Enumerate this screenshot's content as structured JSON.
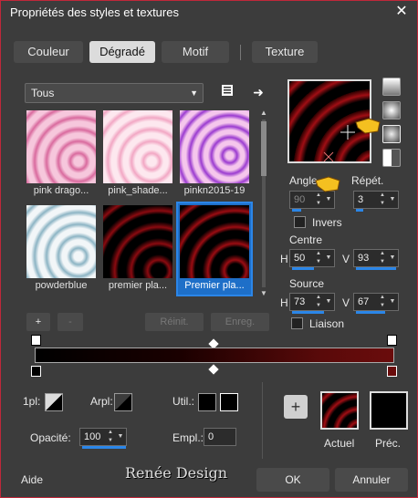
{
  "window": {
    "title": "Propriétés des styles et textures",
    "close_glyph": "✕"
  },
  "tabs": [
    {
      "label": "Couleur"
    },
    {
      "label": "Dégradé",
      "active": true
    },
    {
      "label": "Motif"
    },
    {
      "label": "Texture"
    }
  ],
  "category": {
    "selected": "Tous"
  },
  "gallery": {
    "items": [
      {
        "caption": "pink drago..."
      },
      {
        "caption": "pink_shade..."
      },
      {
        "caption": "pinkn2015-19"
      },
      {
        "caption": "powderblue"
      },
      {
        "caption": "premier pla..."
      },
      {
        "caption": "Premier pla...",
        "selected": true
      }
    ]
  },
  "gallery_buttons": {
    "add": "+",
    "remove": "-",
    "reset": "Réinit.",
    "save": "Enreg."
  },
  "params": {
    "angle_label": "Angle",
    "angle_value": "90",
    "repeat_label": "Répét.",
    "repeat_value": "3",
    "invert_label": "Invers",
    "center_label": "Centre",
    "center_h": "50",
    "center_v": "93",
    "source_label": "Source",
    "source_h": "73",
    "source_v": "67",
    "link_label": "Liaison",
    "h_label": "H",
    "v_label": "V"
  },
  "bottom": {
    "p1_label": "1pl:",
    "arpl_label": "Arpl:",
    "util_label": "Util.:",
    "opacity_label": "Opacité:",
    "opacity_value": "100",
    "empl_label": "Empl.:",
    "empl_value": "0",
    "add_glyph": "+",
    "current_label": "Actuel",
    "previous_label": "Préc."
  },
  "footer": {
    "help": "Aide",
    "logo": "Renée Design",
    "ok": "OK",
    "cancel": "Annuler"
  },
  "colors": {
    "accent": "#2b86e8",
    "danger": "#c0283a",
    "gradient_end": "#6a0c0c"
  }
}
